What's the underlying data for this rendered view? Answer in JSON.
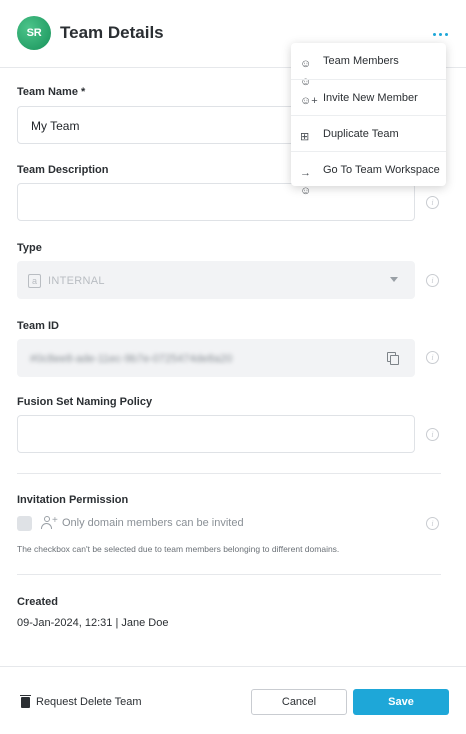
{
  "header": {
    "logo_text": "SR",
    "title": "Team Details",
    "more_icon": "more-horizontal-icon",
    "accent_color": "#1ea7d8"
  },
  "form": {
    "team_name": {
      "label": "Team Name *",
      "value": "My Team"
    },
    "team_description": {
      "label": "Team Description",
      "value": ""
    },
    "type": {
      "label": "Type",
      "value": "INTERNAL"
    },
    "team_id": {
      "label": "Team ID",
      "value": "#0c8ee8-ade-11ec-9b7e-0725474de8a20"
    },
    "fusion_policy": {
      "label": "Fusion Set Naming Policy",
      "value": ""
    },
    "invitation": {
      "label": "Invitation Permission",
      "checkbox_label": "Only domain members can be invited",
      "note": "The checkbox can't be selected due to team members belonging to different domains."
    },
    "created": {
      "label": "Created",
      "value": "09-Jan-2024, 12:31 | Jane Doe"
    }
  },
  "footer": {
    "delete_label": "Request Delete Team",
    "cancel_label": "Cancel",
    "save_label": "Save"
  },
  "menu": {
    "items": [
      {
        "label": "Team Members",
        "icon": "team-members-icon"
      },
      {
        "label": "Invite New Member",
        "icon": "invite-member-icon"
      },
      {
        "label": "Duplicate Team",
        "icon": "duplicate-icon"
      },
      {
        "label": "Go To Team Workspace",
        "icon": "go-to-workspace-icon"
      }
    ]
  }
}
